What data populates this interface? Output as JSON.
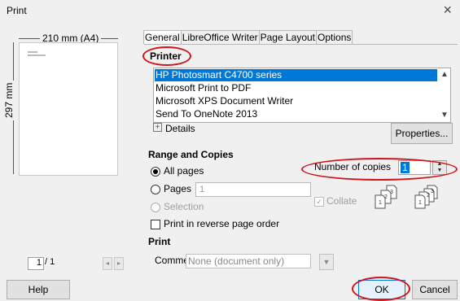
{
  "window": {
    "title": "Print",
    "close_glyph": "×"
  },
  "preview": {
    "paper_width_label": "210 mm (A4)",
    "paper_height_label": "297 mm",
    "page_current": "1",
    "page_total": "/ 1",
    "prev_glyph": "◂",
    "next_glyph": "▸"
  },
  "tabs": [
    "General",
    "LibreOffice Writer",
    "Page Layout",
    "Options"
  ],
  "printer": {
    "section_label": "Printer",
    "list": [
      "HP Photosmart C4700 series",
      "Microsoft Print to PDF",
      "Microsoft XPS Document Writer",
      "Send To OneNote 2013"
    ],
    "selected_index": 0,
    "details_label": "Details",
    "properties_label": "Properties..."
  },
  "range": {
    "section_label": "Range and Copies",
    "all_pages_label": "All pages",
    "pages_label": "Pages",
    "pages_value": "1",
    "selection_label": "Selection",
    "reverse_label": "Print in reverse page order",
    "copies_label": "Number of copies",
    "copies_value": "1",
    "collate_label": "Collate"
  },
  "print": {
    "section_label": "Print",
    "comments_label": "Comments",
    "comments_value": "None (document only)"
  },
  "buttons": {
    "help": "Help",
    "ok": "OK",
    "cancel": "Cancel"
  },
  "colors": {
    "selection": "#0078d7",
    "annotation": "#d0141b"
  }
}
